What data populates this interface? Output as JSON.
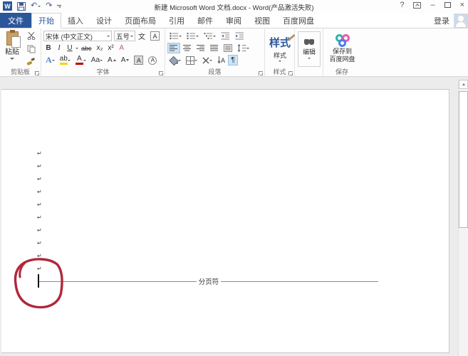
{
  "titlebar": {
    "title": "新建 Microsoft Word 文档.docx - Word(产品激活失败)",
    "help_label": "?",
    "minimize_label": "–",
    "close_label": "×"
  },
  "icons": {
    "word_logo": "W",
    "undo": "↶",
    "redo": "↷",
    "scissors": "✂",
    "down_arrow": "↓",
    "line_spacing": "↕"
  },
  "tab_bar": {
    "file_tab": "文件",
    "tabs": [
      "开始",
      "插入",
      "设计",
      "页面布局",
      "引用",
      "邮件",
      "审阅",
      "视图",
      "百度网盘"
    ],
    "signin_label": "登录"
  },
  "ribbon": {
    "clipboard": {
      "group_label": "剪贴板",
      "paste_label": "粘贴"
    },
    "font": {
      "group_label": "字体",
      "font_name": "宋体 (中文正文)",
      "font_size": "五号",
      "bold": "B",
      "italic": "I",
      "underline": "U",
      "strikethrough": "abc",
      "subscript": "x₂",
      "superscript": "x²",
      "phonetic_guide": "文",
      "char_border": "A",
      "pinyin": "A",
      "text_effects": "A",
      "highlight": "ab",
      "font_color": "A",
      "change_case": "Aa",
      "grow_font": "A",
      "shrink_font": "A",
      "char_shading": "A",
      "enclose_char": "A"
    },
    "paragraph": {
      "group_label": "段落",
      "sort": "A",
      "pilcrow": "¶"
    },
    "styles": {
      "group_label": "样式",
      "button_label": "样式"
    },
    "editing": {
      "button_label": "编辑"
    },
    "baidu_save": {
      "group_label": "保存",
      "button_line1": "保存到",
      "button_line2": "百度网盘"
    }
  },
  "document": {
    "paragraph_mark": "↵",
    "page_break_label": "分页符"
  },
  "colors": {
    "accent_blue": "#2b579a",
    "selection_blue": "#cce4f7",
    "annotation_red": "#b1273b"
  }
}
